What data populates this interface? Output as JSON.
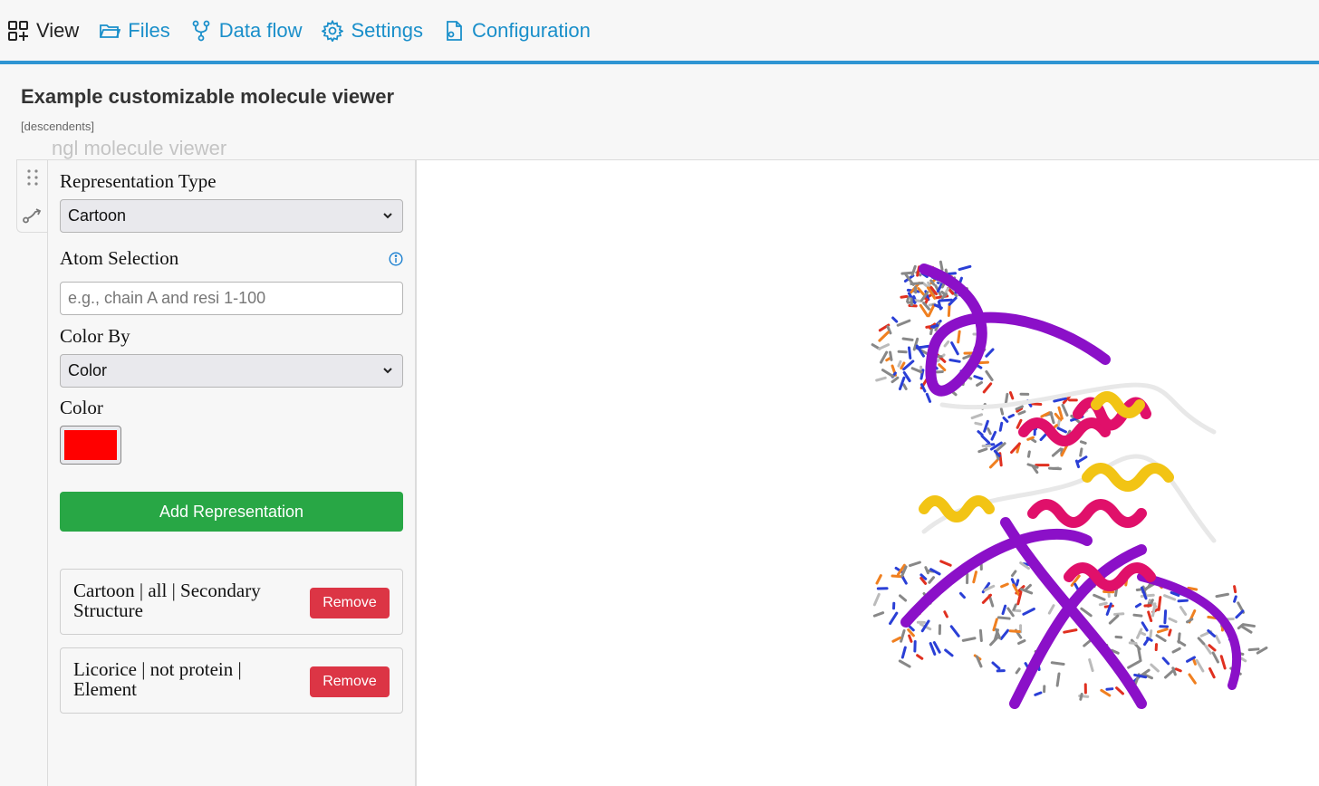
{
  "nav": {
    "items": [
      {
        "label": "View",
        "icon": "view-grid-plus-icon",
        "active": true
      },
      {
        "label": "Files",
        "icon": "folder-icon"
      },
      {
        "label": "Data flow",
        "icon": "data-flow-icon"
      },
      {
        "label": "Settings",
        "icon": "gear-icon"
      },
      {
        "label": "Configuration",
        "icon": "config-file-icon"
      }
    ],
    "accent_color": "#2f95d3"
  },
  "page": {
    "title": "Example customizable molecule viewer",
    "tag": "[descendents]",
    "ghost_label": "ngl molecule viewer"
  },
  "controls": {
    "representation_type": {
      "label": "Representation Type",
      "selected": "Cartoon"
    },
    "atom_selection": {
      "label": "Atom Selection",
      "placeholder": "e.g., chain A and resi 1-100",
      "value": ""
    },
    "color_by": {
      "label": "Color By",
      "selected": "Color"
    },
    "color": {
      "label": "Color",
      "value": "#ff0000"
    },
    "add_button_label": "Add Representation",
    "add_button_color": "#28a745"
  },
  "representations": [
    {
      "text": "Cartoon | all | Secondary Structure",
      "remove_label": "Remove"
    },
    {
      "text": "Licorice | not protein | Element",
      "remove_label": "Remove"
    }
  ],
  "remove_button_color": "#dc3545",
  "molecule_colors": {
    "nucleic_ribbon": "#8b10c8",
    "helix": "#e0106a",
    "strand": "#f2c414",
    "coil": "#e8e8e8"
  }
}
